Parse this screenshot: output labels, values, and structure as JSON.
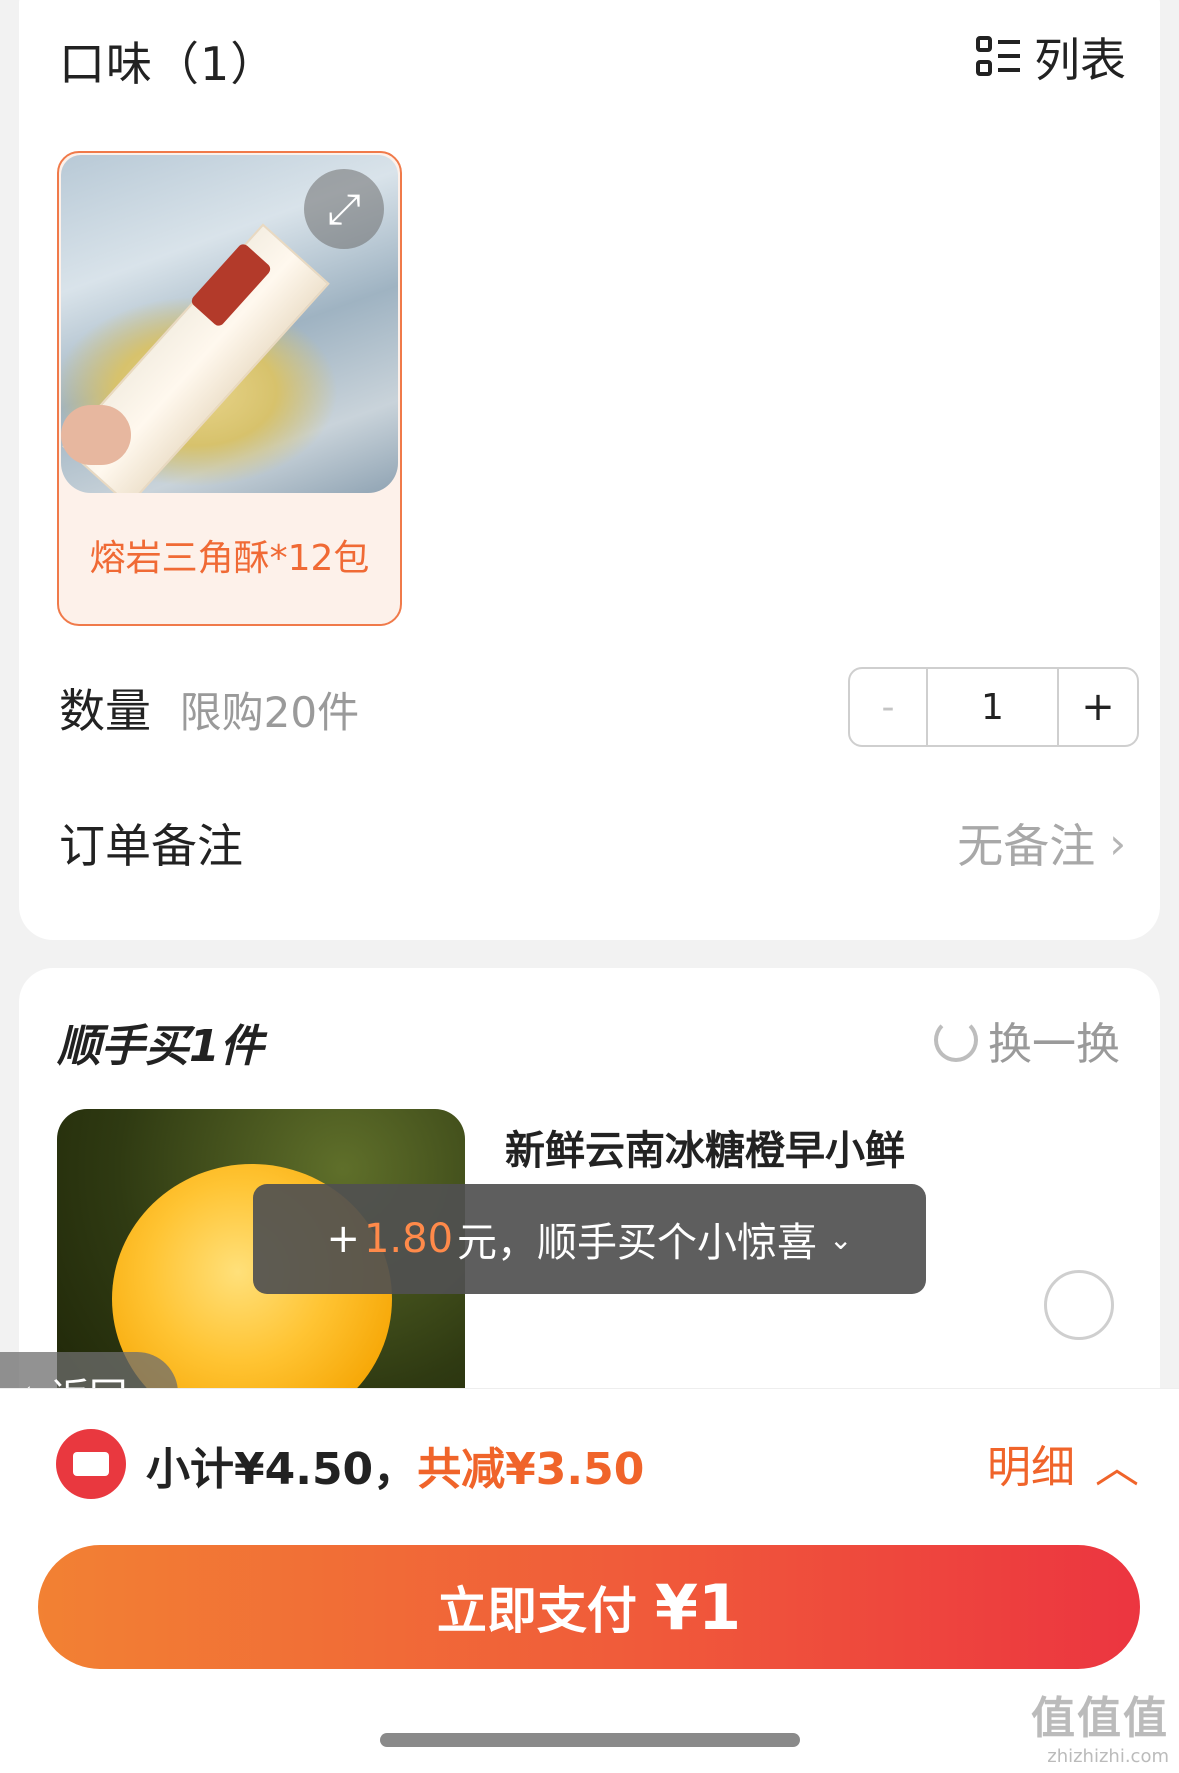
{
  "flavor_section": {
    "title": "口味（1）",
    "list_toggle_label": "列表",
    "variants": [
      {
        "label": "熔岩三角酥*12包",
        "selected": true
      }
    ]
  },
  "quantity": {
    "label": "数量",
    "limit_text": "限购20件",
    "minus": "-",
    "value": "1",
    "plus": "+"
  },
  "order_note": {
    "label": "订单备注",
    "value": "无备注"
  },
  "addon_section": {
    "title": "顺手买1件",
    "refresh_label": "换一换",
    "product_name": "新鲜云南冰糖橙早小鲜"
  },
  "toast": {
    "prefix": "+",
    "amount": "1.80",
    "suffix": "元，顺手买个小惊喜"
  },
  "back_button": {
    "label": "返回"
  },
  "summary": {
    "subtotal": "小计¥4.50，",
    "discount": "共减¥3.50",
    "detail_label": "明细"
  },
  "pay_button": {
    "label": "立即支付",
    "amount": "¥1"
  },
  "watermark": {
    "big": "值值值",
    "small": "zhizhizhi.com"
  },
  "colors": {
    "accent": "#f0642a",
    "pay_gradient_start": "#f28133",
    "pay_gradient_end": "#ec3540"
  }
}
